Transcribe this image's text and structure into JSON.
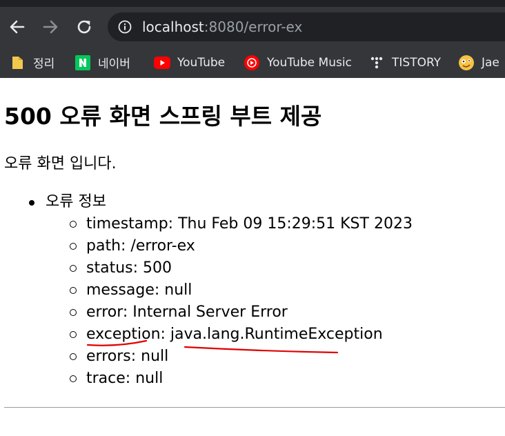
{
  "browser": {
    "url_host": "localhost",
    "url_rest": ":8080/error-ex",
    "bookmarks": [
      {
        "label": "정리",
        "icon": "folder-icon"
      },
      {
        "label": "네이버",
        "icon": "naver-icon"
      },
      {
        "label": "YouTube",
        "icon": "youtube-icon"
      },
      {
        "label": "YouTube Music",
        "icon": "youtube-music-icon"
      },
      {
        "label": "TISTORY",
        "icon": "tistory-icon"
      },
      {
        "label": "Jae",
        "icon": "emoji-icon"
      }
    ]
  },
  "page": {
    "title": "500 오류 화면 스프링 부트 제공",
    "description": "오류 화면 입니다.",
    "info_heading": "오류 정보",
    "info_items": [
      "timestamp: Thu Feb 09 15:29:51 KST 2023",
      "path: /error-ex",
      "status: 500",
      "message: null",
      "error: Internal Server Error",
      "exception: java.lang.RuntimeException",
      "errors: null",
      "trace: null"
    ]
  },
  "colors": {
    "chrome_bg": "#35363a",
    "omnibox_bg": "#202124",
    "annotation_underline": "#e00000"
  }
}
